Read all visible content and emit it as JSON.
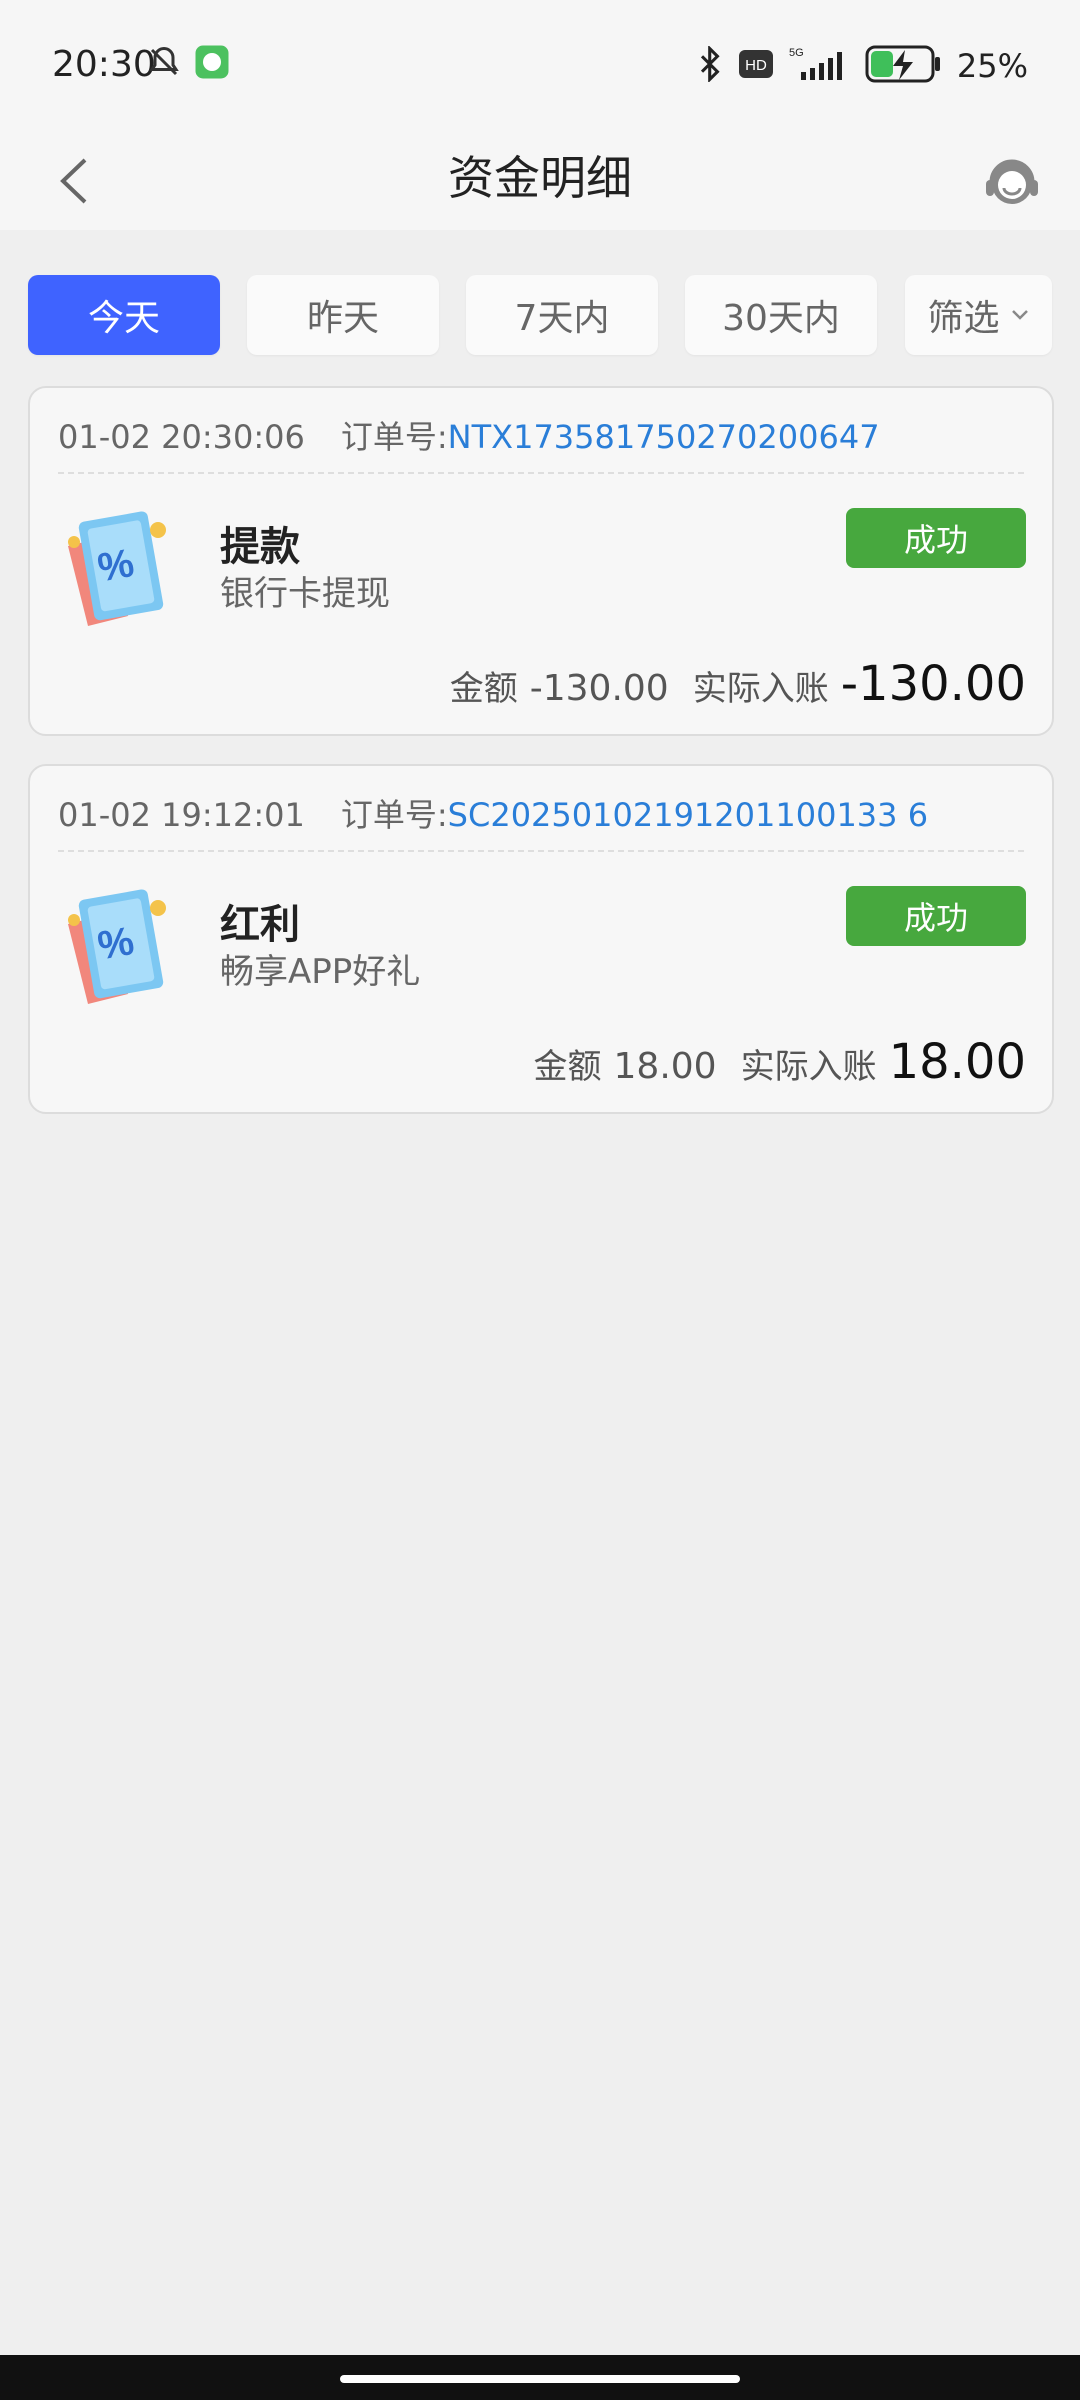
{
  "status_bar": {
    "time": "20:30",
    "battery": "25%",
    "network": "5G",
    "hd_label": "HD"
  },
  "header": {
    "title": "资金明细"
  },
  "filters": [
    {
      "label": "今天",
      "active": true
    },
    {
      "label": "昨天",
      "active": false
    },
    {
      "label": "7天内",
      "active": false
    },
    {
      "label": "30天内",
      "active": false
    },
    {
      "label": "筛选",
      "active": false
    }
  ],
  "transactions": [
    {
      "time": "01-02 20:30:06",
      "order_label": "订单号:",
      "order_no": "NTX173581750270200647",
      "type": "提款",
      "desc": "银行卡提现",
      "status": "成功",
      "amount_label": "金额",
      "amount": "-130.00",
      "actual_label": "实际入账",
      "actual": "-130.00"
    },
    {
      "time": "01-02 19:12:01",
      "order_label": "订单号:",
      "order_no": "SC20250102191201100133 6",
      "type": "红利",
      "desc": "畅享APP好礼",
      "status": "成功",
      "amount_label": "金额",
      "amount": "18.00",
      "actual_label": "实际入账",
      "actual": "18.00"
    }
  ],
  "colors": {
    "accent": "#3f63ff",
    "success": "#47a83e",
    "order_link": "#2a7ed8"
  }
}
